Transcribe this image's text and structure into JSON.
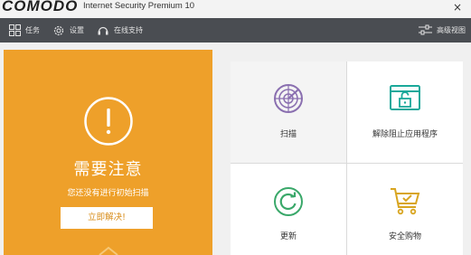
{
  "titlebar": {
    "brand": "COMODO",
    "product": "Internet Security Premium 10",
    "close": "×"
  },
  "toolbar": {
    "tasks": {
      "label": "任务",
      "icon": "grid-icon"
    },
    "settings": {
      "label": "设置",
      "icon": "gear-icon"
    },
    "support": {
      "label": "在线支持",
      "icon": "headset-icon"
    },
    "advanced": {
      "label": "高级视图",
      "icon": "sliders-icon"
    }
  },
  "alert": {
    "icon": "exclamation-circle-icon",
    "title": "需要注意",
    "message": "您还没有进行初始扫描",
    "button": "立即解决!"
  },
  "tiles": [
    {
      "label": "扫描",
      "icon": "radar-scan-icon"
    },
    {
      "label": "解除阻止应用程序",
      "icon": "unlock-window-icon"
    },
    {
      "label": "更新",
      "icon": "refresh-icon"
    },
    {
      "label": "安全购物",
      "icon": "shopping-cart-icon"
    }
  ],
  "colors": {
    "alert_orange": "#eea02a",
    "toolbar_bg": "#4a4d52",
    "scan_purple": "#8a6fb0",
    "teal": "#1aa89a",
    "update_green": "#3aa86a",
    "cart_yellow": "#d8a520"
  }
}
